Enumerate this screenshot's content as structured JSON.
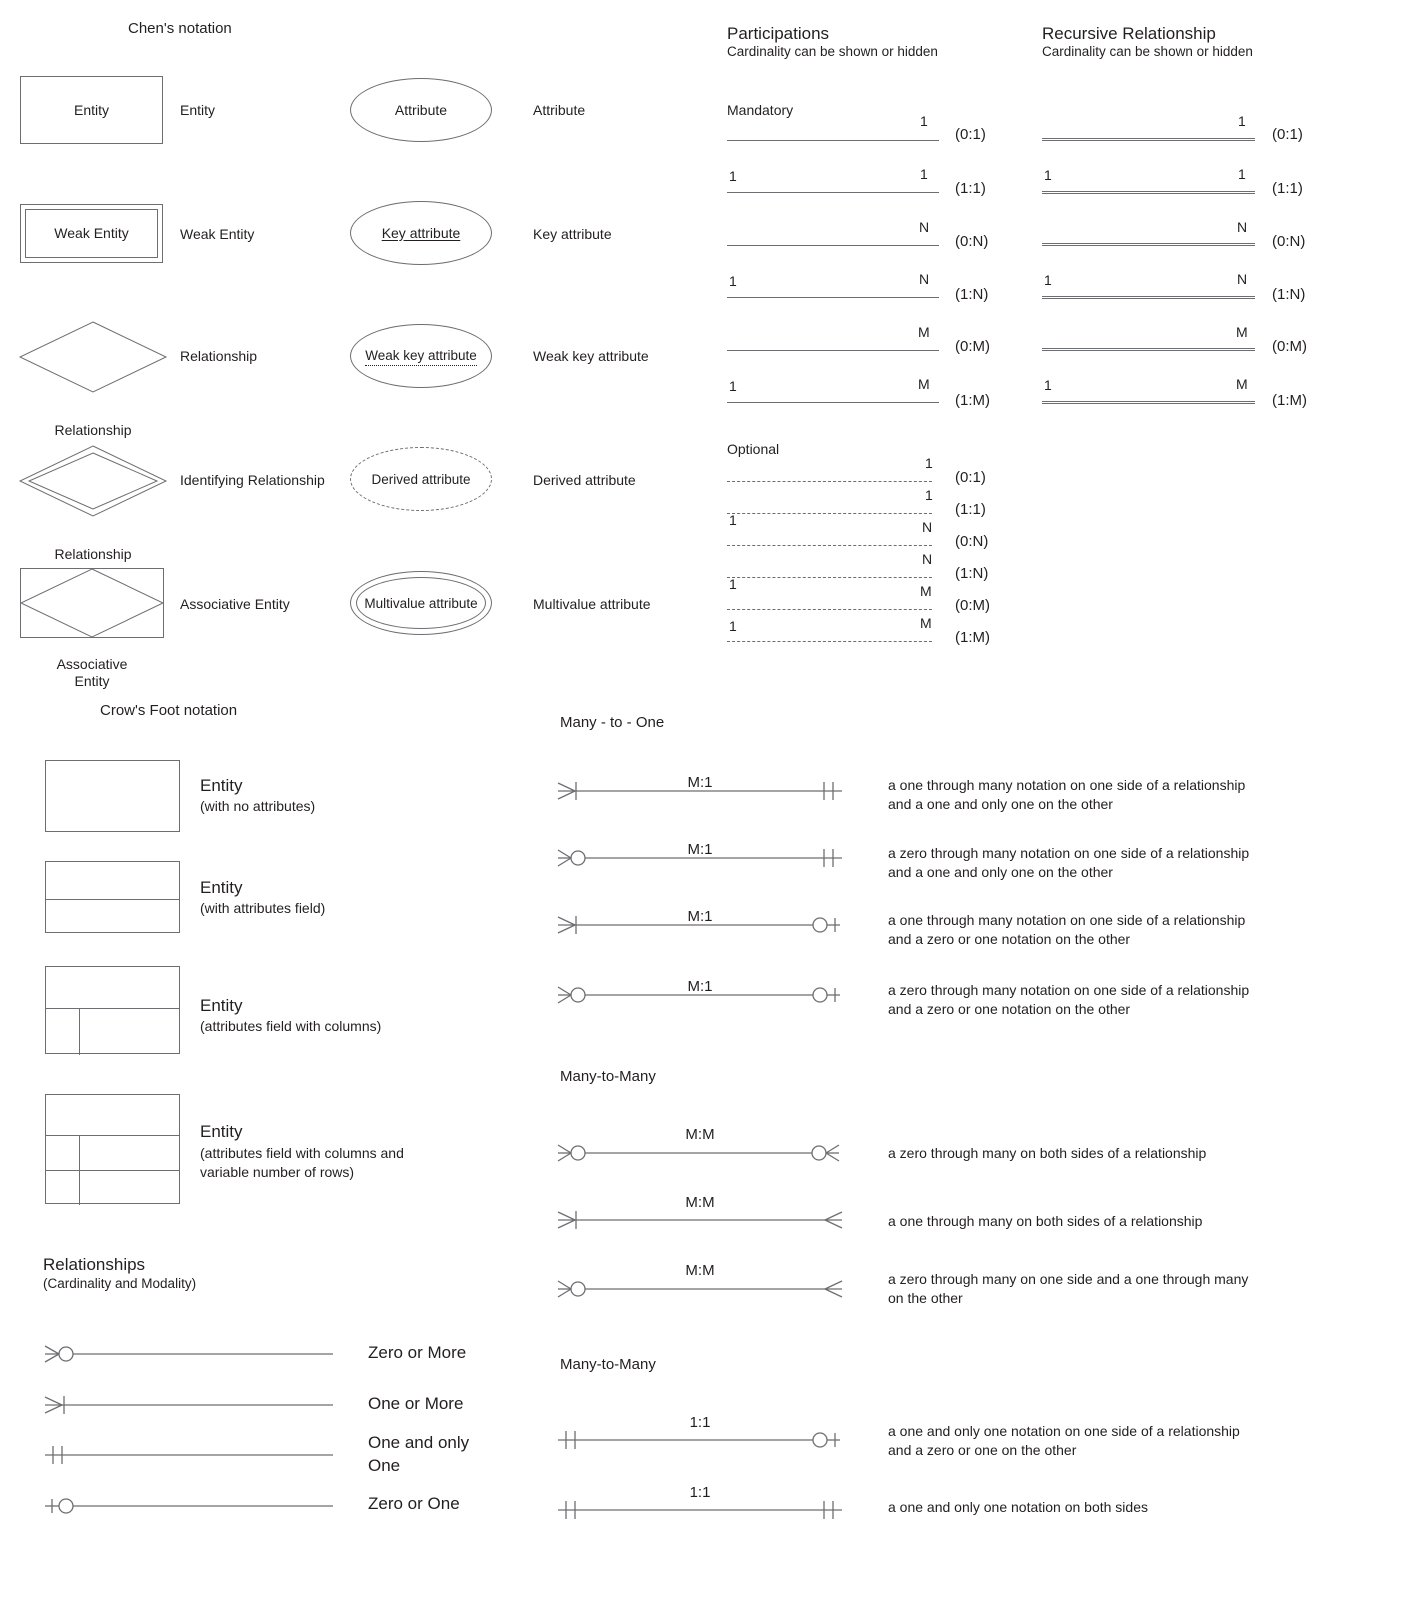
{
  "chen": {
    "title": "Chen's notation",
    "left_items": [
      {
        "shape_text": "Entity",
        "label": "Entity",
        "kind": "rect"
      },
      {
        "shape_text": "Weak Entity",
        "label": "Weak Entity",
        "kind": "double-rect"
      },
      {
        "shape_text": "Relationship",
        "label": "Relationship",
        "kind": "diamond"
      },
      {
        "shape_text": "Relationship",
        "label": "Identifying Relationship",
        "kind": "double-diamond"
      },
      {
        "shape_text": "Associative Entity",
        "shape_line1": "Associative",
        "shape_line2": "Entity",
        "label": "Associative Entity",
        "kind": "assoc"
      }
    ],
    "right_items": [
      {
        "shape_text": "Attribute",
        "label": "Attribute",
        "kind": "ellipse"
      },
      {
        "shape_text": "Key attribute",
        "label": "Key attribute",
        "kind": "ellipse-underline"
      },
      {
        "shape_text": "Weak key attribute",
        "label": "Weak key attribute",
        "kind": "ellipse-dotunderline"
      },
      {
        "shape_text": "Derived attribute",
        "label": "Derived attribute",
        "kind": "ellipse-dashed"
      },
      {
        "shape_text": "Multivalue attribute",
        "label": "Multivalue attribute",
        "kind": "ellipse-double"
      }
    ]
  },
  "participations": {
    "title": "Participations",
    "subtitle": "Cardinality can be shown or hidden",
    "mandatory_label": "Mandatory",
    "optional_label": "Optional",
    "mandatory_rows": [
      {
        "left": "",
        "right": "1",
        "card": "(0:1)"
      },
      {
        "left": "1",
        "right": "1",
        "card": "(1:1)"
      },
      {
        "left": "",
        "right": "N",
        "card": "(0:N)"
      },
      {
        "left": "1",
        "right": "N",
        "card": "(1:N)"
      },
      {
        "left": "",
        "right": "M",
        "card": "(0:M)"
      },
      {
        "left": "1",
        "right": "M",
        "card": "(1:M)"
      }
    ],
    "optional_rows": [
      {
        "left": "",
        "right": "1",
        "card": "(0:1)"
      },
      {
        "left": "",
        "right": "1",
        "card": "(1:1)"
      },
      {
        "left": "1",
        "right": "N",
        "card": "(0:N)"
      },
      {
        "left": "",
        "right": "N",
        "card": "(1:N)"
      },
      {
        "left": "1",
        "right": "M",
        "card": "(0:M)"
      },
      {
        "left": "1",
        "right": "M",
        "card": "(1:M)"
      }
    ]
  },
  "recursive": {
    "title": "Recursive Relationship",
    "subtitle": "Cardinality can be shown or hidden",
    "rows": [
      {
        "left": "",
        "right": "1",
        "card": "(0:1)"
      },
      {
        "left": "1",
        "right": "1",
        "card": "(1:1)"
      },
      {
        "left": "",
        "right": "N",
        "card": "(0:N)"
      },
      {
        "left": "1",
        "right": "N",
        "card": "(1:N)"
      },
      {
        "left": "",
        "right": "M",
        "card": "(0:M)"
      },
      {
        "left": "1",
        "right": "M",
        "card": "(1:M)"
      }
    ]
  },
  "crowsfoot": {
    "title": "Crow's Foot notation",
    "entities": [
      {
        "label": "Entity",
        "sub": "(with no attributes)"
      },
      {
        "label": "Entity",
        "sub": "(with attributes field)"
      },
      {
        "label": "Entity",
        "sub": "(attributes field with columns)"
      },
      {
        "label": "Entity",
        "sub": "(attributes field with columns and",
        "sub2": "variable number of rows)"
      }
    ],
    "relationships_title": "Relationships",
    "relationships_sub": "(Cardinality and Modality)",
    "modality_rows": [
      {
        "symbol": "zero-or-more",
        "label": "Zero or More"
      },
      {
        "symbol": "one-or-more",
        "label": "One or More"
      },
      {
        "symbol": "one-and-only-one",
        "label": "One and only",
        "label2": "One"
      },
      {
        "symbol": "zero-or-one",
        "label": "Zero or One"
      }
    ]
  },
  "many_to_one": {
    "title": "Many - to - One",
    "rows": [
      {
        "tag": "M:1",
        "left_symbol": "one-or-more",
        "right_symbol": "one-and-only-one",
        "desc1": "a one through many notation on one side of a relationship",
        "desc2": "and a one and only one on the other"
      },
      {
        "tag": "M:1",
        "left_symbol": "zero-or-more",
        "right_symbol": "one-and-only-one",
        "desc1": "a zero through many notation on one side of a relationship",
        "desc2": "and a one and only one on the other"
      },
      {
        "tag": "M:1",
        "left_symbol": "one-or-more",
        "right_symbol": "zero-or-one",
        "desc1": "a one through many notation on one side of a relationship",
        "desc2": "and a zero or one notation on the other"
      },
      {
        "tag": "M:1",
        "left_symbol": "zero-or-more",
        "right_symbol": "zero-or-one",
        "desc1": "a zero through many notation on one side of a relationship",
        "desc2": "and a zero or one notation on the other"
      }
    ]
  },
  "many_to_many": {
    "title": "Many-to-Many",
    "rows": [
      {
        "tag": "M:M",
        "left_symbol": "zero-or-more",
        "right_symbol": "zero-or-more",
        "desc1": "a zero through many on both sides of a relationship",
        "desc2": ""
      },
      {
        "tag": "M:M",
        "left_symbol": "one-or-more",
        "right_symbol": "one-or-more",
        "desc1": "a one through many on both sides of a relationship",
        "desc2": ""
      },
      {
        "tag": "M:M",
        "left_symbol": "zero-or-more",
        "right_symbol": "one-or-more",
        "desc1": "a zero through many on one side and a one through many",
        "desc2": "on the other"
      }
    ]
  },
  "one_to_one": {
    "title": "Many-to-Many",
    "rows": [
      {
        "tag": "1:1",
        "left_symbol": "one-and-only-one",
        "right_symbol": "zero-or-one",
        "desc1": "a one and only one notation on one side of a relationship",
        "desc2": "and a zero or one on the other"
      },
      {
        "tag": "1:1",
        "left_symbol": "one-and-only-one",
        "right_symbol": "one-and-only-one",
        "desc1": "a one and only one notation on both sides",
        "desc2": ""
      }
    ]
  },
  "colors": {
    "stroke": "#6d6e71",
    "text": "#231f20",
    "background": "#ffffff"
  }
}
